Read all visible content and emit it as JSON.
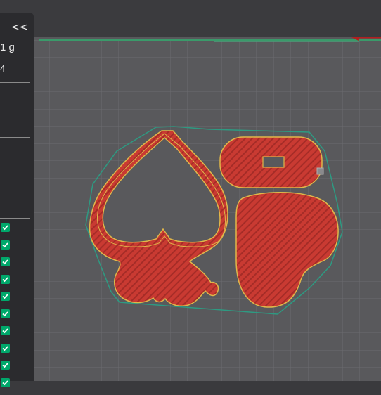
{
  "left_panel": {
    "collapse_label": "<<",
    "filament_weight": "1 g",
    "secondary_value": "4",
    "checkbox_count": 10,
    "checkbox_color": "#00a86b"
  },
  "plate": {
    "background_color": "#58585b",
    "grid_color": "#6a6a6d",
    "major_grid_color": "#777779",
    "object_fill": "#c93a32",
    "object_outline": "#e0b74a",
    "skirt_color": "#2e9a82"
  },
  "icons": [
    "collapse-arrows-icon",
    "checkbox-checked-icon",
    "axis-arrow-icon"
  ]
}
